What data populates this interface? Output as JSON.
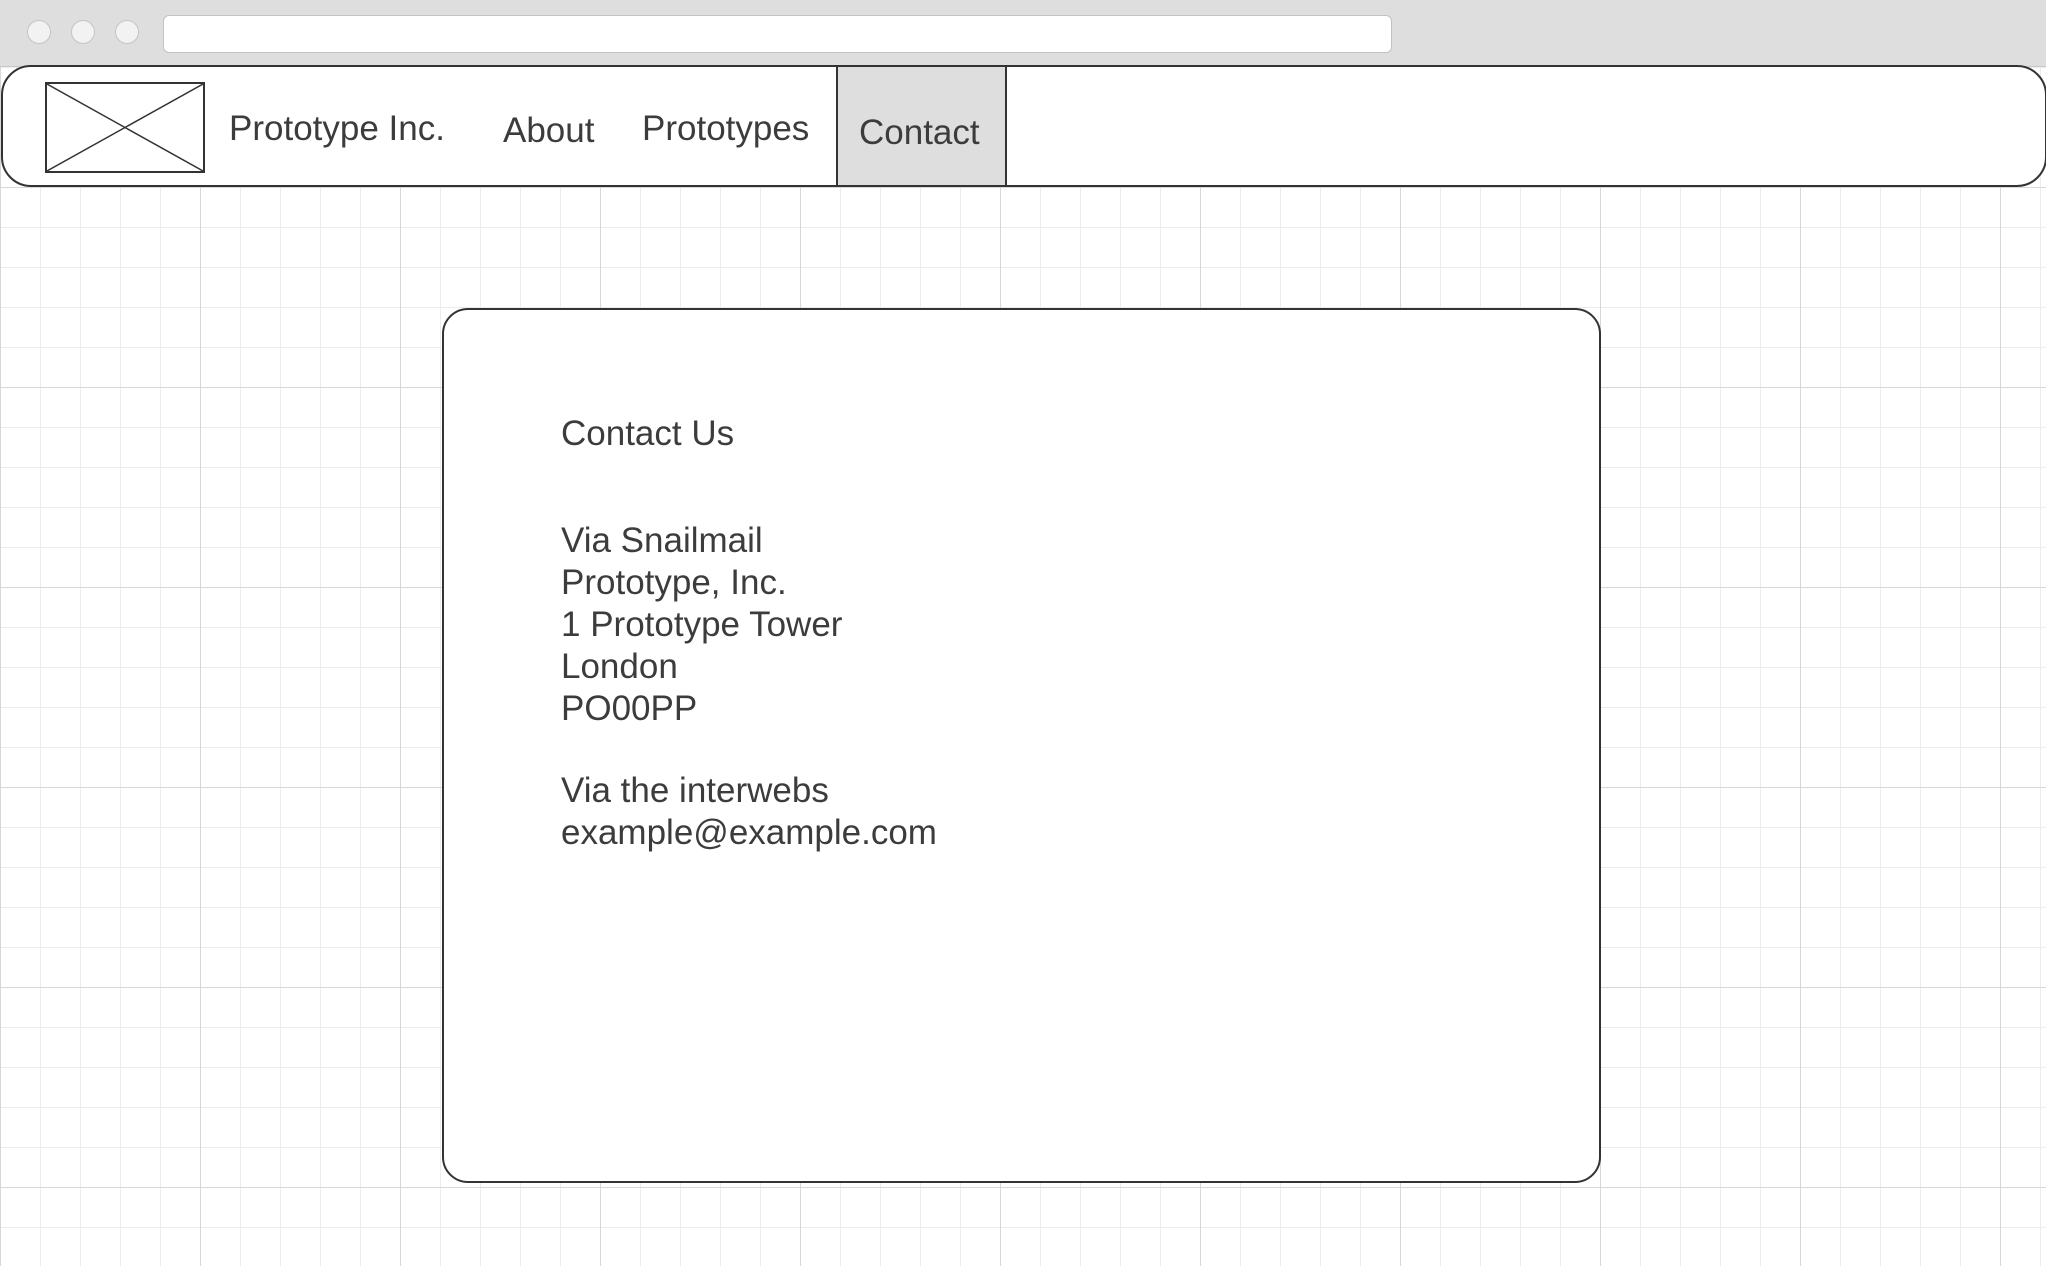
{
  "window": {
    "traffic_lights": [
      "close",
      "minimize",
      "maximize"
    ],
    "address_bar": ""
  },
  "nav": {
    "logo_icon": "image-placeholder-icon",
    "brand": "Prototype Inc.",
    "items": [
      {
        "label": "About",
        "active": false
      },
      {
        "label": "Prototypes",
        "active": false
      },
      {
        "label": "Contact",
        "active": true
      }
    ],
    "active_color": "#dedede"
  },
  "contact": {
    "heading": "Contact Us",
    "snailmail": {
      "title": "Via Snailmail",
      "lines": [
        "Prototype, Inc.",
        "1 Prototype Tower",
        "London",
        "PO00PP"
      ]
    },
    "web": {
      "title": "Via the interwebs",
      "email": "example@example.com"
    }
  }
}
